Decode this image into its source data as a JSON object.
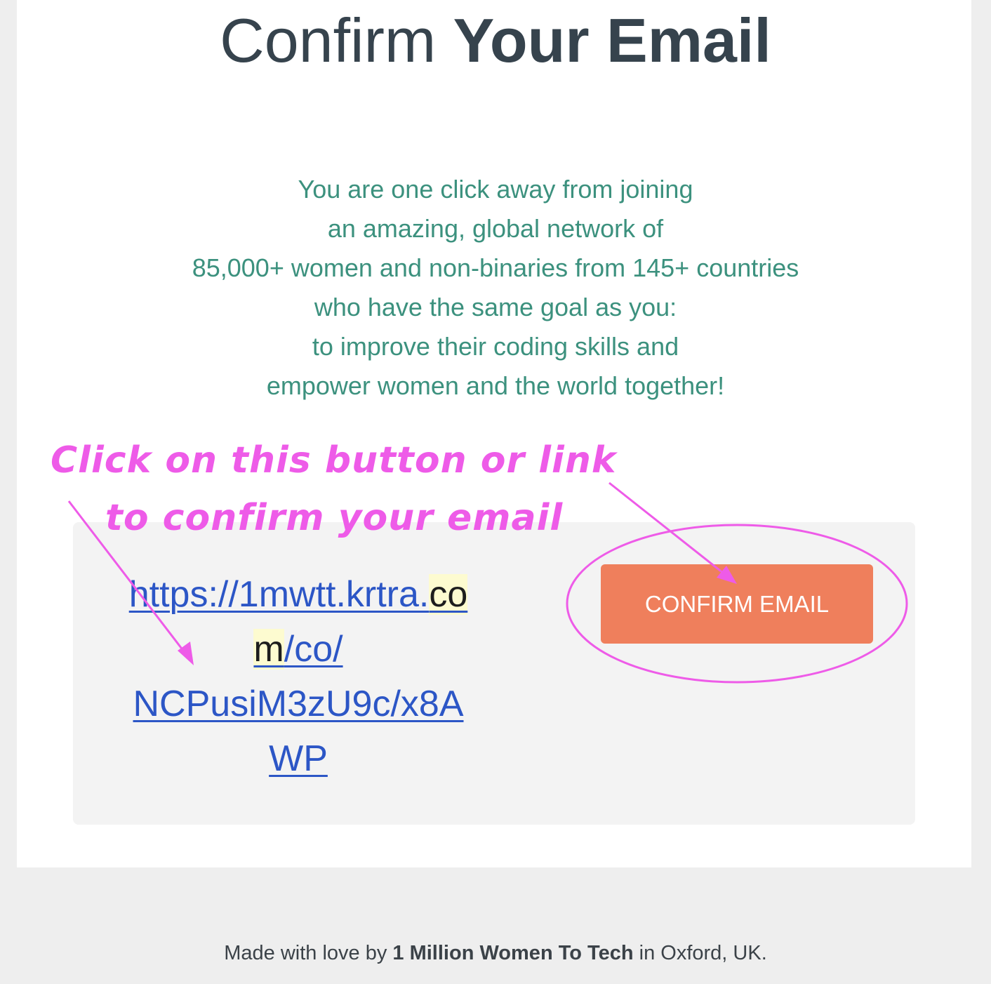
{
  "header": {
    "title_light": "Confirm",
    "title_bold": "Your Email"
  },
  "intro": {
    "lines": [
      "You are one click away from joining",
      "an amazing, global network of",
      "85,000+ women and non-binaries from 145+ countries",
      "who have the same goal as you:",
      "to improve their coding skills and",
      "empower women and the world together!"
    ]
  },
  "annotation": {
    "line1": "Click on this button or link",
    "line2": "to confirm your email",
    "color": "#ee5be8"
  },
  "confirm_link": {
    "line1_main": "https://1mwtt.krtra.",
    "line1_highlight": "co",
    "line2_highlight": "m",
    "line2_main": "/co/",
    "line3": "NCPusiM3zU9c/x8A",
    "line4": "WP"
  },
  "confirm_button": {
    "label": "CONFIRM EMAIL",
    "color": "#ef7f5c"
  },
  "footer": {
    "prefix": "Made with love by",
    "org": "1 Million Women To Tech",
    "suffix": "in Oxford, UK."
  }
}
